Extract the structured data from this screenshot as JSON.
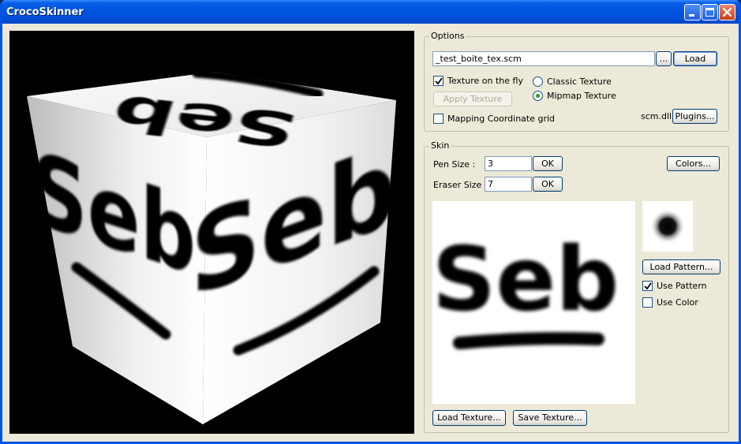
{
  "window": {
    "title": "CrocoSkinner"
  },
  "options": {
    "group_label": "Options",
    "file_value": "_test_boite_tex.scm",
    "browse_label": "...",
    "load_label": "Load",
    "texture_on_fly_label": "Texture on the fly",
    "texture_on_fly_checked": true,
    "apply_texture_label": "Apply Texture",
    "classic_texture_label": "Classic Texture",
    "mipmap_texture_label": "Mipmap Texture",
    "selected_texture_mode": "mipmap",
    "mapping_grid_label": "Mapping Coordinate grid",
    "mapping_grid_checked": false,
    "plugin_name": "scm.dll",
    "plugins_label": "Plugins..."
  },
  "skin": {
    "group_label": "Skin",
    "pen_size_label": "Pen Size :",
    "pen_size_value": "3",
    "eraser_size_label": "Eraser Size :",
    "eraser_size_value": "7",
    "ok_label": "OK",
    "colors_label": "Colors...",
    "load_pattern_label": "Load Pattern...",
    "use_pattern_label": "Use Pattern",
    "use_pattern_checked": true,
    "use_color_label": "Use Color",
    "use_color_checked": false,
    "load_texture_label": "Load Texture...",
    "save_texture_label": "Save Texture...",
    "texture_text": "Seb"
  },
  "cube": {
    "text": "Seb"
  },
  "colors": {
    "title_bar": "#0054e3",
    "face": "#ece9d8",
    "close_button": "#c5401c"
  }
}
